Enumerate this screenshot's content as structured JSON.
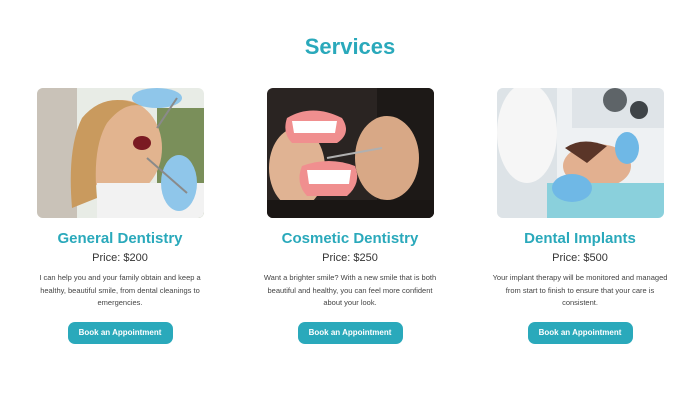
{
  "section": {
    "title": "Services"
  },
  "services": [
    {
      "name": "General Dentistry",
      "price": "Price: $200",
      "description": "I can help you and your family obtain and keep a healthy, beautiful smile, from dental cleanings to emergencies.",
      "button_label": "Book an Appointment"
    },
    {
      "name": "Cosmetic Dentistry",
      "price": "Price: $250",
      "description": "Want a brighter smile? With a new smile that is both beautiful and healthy, you can feel more confident about your look.",
      "button_label": "Book an Appointment"
    },
    {
      "name": "Dental Implants",
      "price": "Price: $500",
      "description": "Your implant therapy will be monitored and managed from start to finish to ensure that your care is consistent.",
      "button_label": "Book an Appointment"
    }
  ],
  "colors": {
    "accent": "#2aa9bb"
  }
}
